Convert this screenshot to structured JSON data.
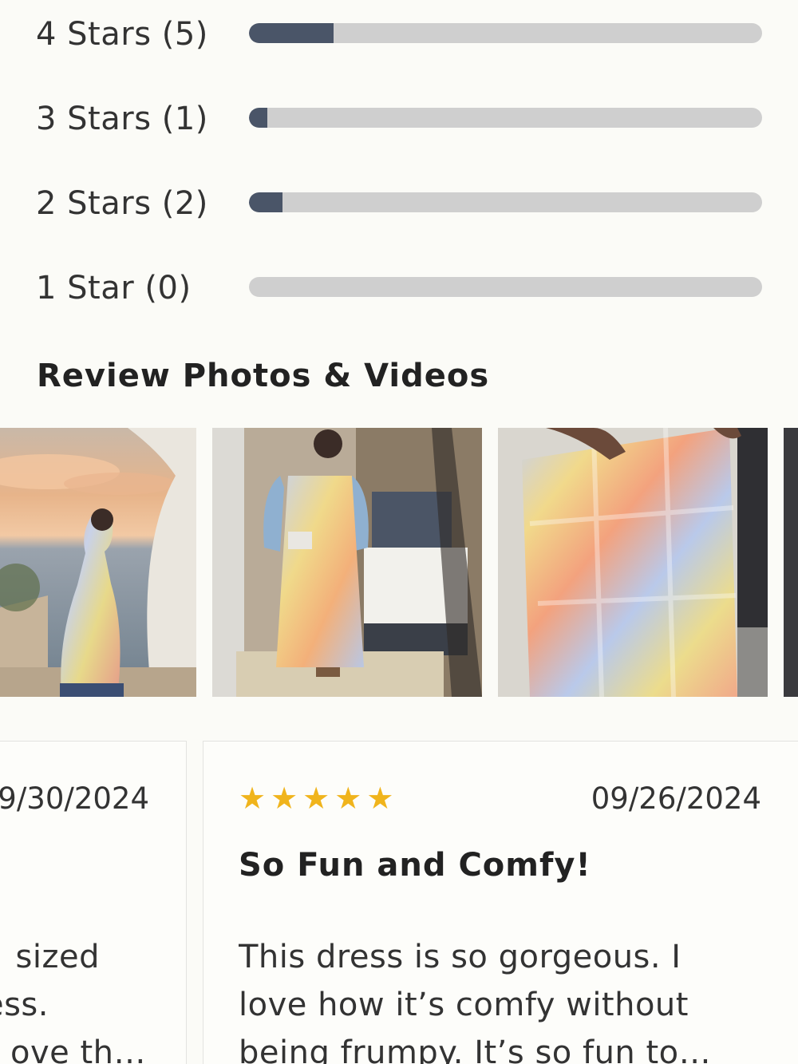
{
  "ratings": [
    {
      "label": "4 Stars (5)",
      "fraction": 0.165
    },
    {
      "label": "3 Stars (1)",
      "fraction": 0.035
    },
    {
      "label": "2 Stars (2)",
      "fraction": 0.066
    },
    {
      "label": "1 Star (0)",
      "fraction": 0.0
    }
  ],
  "media_section": {
    "title": "Review Photos & Videos"
  },
  "photos": [
    {
      "subject": "woman-on-balcony-at-sunset"
    },
    {
      "subject": "mirror-selfie-in-hotel-room"
    },
    {
      "subject": "dress-fabric-closeup"
    }
  ],
  "reviews": [
    {
      "date": "9/30/2024",
      "body_lines": [
        "sized",
        "ess.",
        "ove th…"
      ]
    },
    {
      "stars": 5,
      "date": "09/26/2024",
      "title": "So Fun and Comfy!",
      "body_lines": [
        "This dress is so gorgeous. I",
        "love how it’s comfy without",
        "being frumpy. It’s so fun to…"
      ]
    }
  ],
  "colors": {
    "background": "#fbfbf7",
    "bar_fill": "#4a5568",
    "bar_track": "#cfcfcf",
    "star": "#f0b41c"
  }
}
